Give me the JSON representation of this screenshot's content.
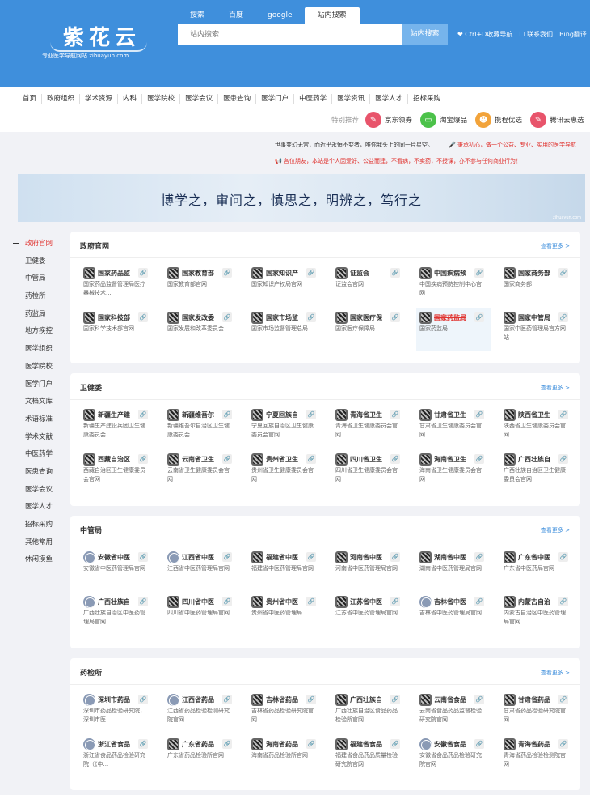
{
  "logo": {
    "main": "紫花云",
    "sub": "专业医学导航网站 zihuayun.com"
  },
  "search": {
    "tabs": [
      "搜索",
      "百度",
      "google",
      "站内搜索"
    ],
    "active_tab": 3,
    "placeholder": "站内搜索",
    "button": "站内搜索"
  },
  "header_links": [
    "❤ Ctrl+D收藏导航",
    "☐ 联系我们",
    "Bing翻译"
  ],
  "nav": [
    "首页",
    "政府组织",
    "学术资源",
    "内科",
    "医学院校",
    "医学会议",
    "医患查询",
    "医学门户",
    "中医药学",
    "医学资讯",
    "医学人才",
    "招标采购"
  ],
  "recommend": {
    "label": "特别推荐",
    "items": [
      {
        "label": "京东领券",
        "icon": "coupon-icon",
        "color": "#e8546b"
      },
      {
        "label": "淘宝爆品",
        "icon": "chat-icon",
        "color": "#4cc24a"
      },
      {
        "label": "携程优选",
        "icon": "mascot-icon",
        "color": "#f2a33a"
      },
      {
        "label": "腾讯云惠选",
        "icon": "coupon-icon",
        "color": "#e8546b"
      }
    ]
  },
  "notice": {
    "line1": "世事变幻无常，而近乎永恒不变者，唯你我头上的同一片星空。",
    "line1_right": "🎤 秉承初心，做一个公益、专业、实用的医学导航",
    "line2": "📢 各位朋友，本站是个人因爱好、公益而建，不看病，不卖药，不授课，亦不参与任何商业行为！"
  },
  "banner": {
    "text": "博学之，审问之，慎思之，明辨之，笃行之",
    "small": "zihuayun.com"
  },
  "sidebar": [
    "政府官网",
    "卫健委",
    "中管局",
    "药检所",
    "药监局",
    "地方疾控",
    "医学组织",
    "医学院校",
    "医学门户",
    "文档文库",
    "术语标准",
    "学术文献",
    "中医药学",
    "医患查询",
    "医学会议",
    "医学人才",
    "招标采购",
    "其他常用",
    "休闲摸鱼"
  ],
  "more_label": "查看更多 >",
  "sections": [
    {
      "title": "政府官网",
      "cards": [
        {
          "name": "国家药品监",
          "desc": "国家药品监督管理局医疗器械技术...",
          "icon": "qr"
        },
        {
          "name": "国家教育部",
          "desc": "国家教育部官网",
          "icon": "qr"
        },
        {
          "name": "国家知识产",
          "desc": "国家知识产权局官网",
          "icon": "qr"
        },
        {
          "name": "证监会",
          "desc": "证监会官网",
          "icon": "qr"
        },
        {
          "name": "中国疾病预",
          "desc": "中国疾病预防控制中心官网",
          "icon": "qr"
        },
        {
          "name": "国家商务部",
          "desc": "国家商务部",
          "icon": "qr"
        },
        {
          "name": "国家科技部",
          "desc": "国家科学技术部官网",
          "icon": "qr"
        },
        {
          "name": "国家发改委",
          "desc": "国家发展和改革委员会",
          "icon": "qr"
        },
        {
          "name": "国家市场监",
          "desc": "国家市场监督管理总局",
          "icon": "qr"
        },
        {
          "name": "国家医疗保",
          "desc": "国家医疗保障局",
          "icon": "qr"
        },
        {
          "name": "国家药监局",
          "desc": "国家药监局",
          "icon": "qr",
          "highlight": true
        },
        {
          "name": "国家中管局",
          "desc": "国家中医药管理局官方网站",
          "icon": "qr"
        }
      ]
    },
    {
      "title": "卫健委",
      "cards": [
        {
          "name": "新疆生产建",
          "desc": "新疆生产建设兵团卫生健康委员会...",
          "icon": "qr"
        },
        {
          "name": "新疆维吾尔",
          "desc": "新疆维吾尔自治区卫生健康委员会...",
          "icon": "qr"
        },
        {
          "name": "宁夏回族自",
          "desc": "宁夏回族自治区卫生健康委员会官网",
          "icon": "qr"
        },
        {
          "name": "青海省卫生",
          "desc": "青海省卫生健康委员会官网",
          "icon": "qr"
        },
        {
          "name": "甘肃省卫生",
          "desc": "甘肃省卫生健康委员会官网",
          "icon": "qr"
        },
        {
          "name": "陕西省卫生",
          "desc": "陕西省卫生健康委员会官网",
          "icon": "qr"
        },
        {
          "name": "西藏自治区",
          "desc": "西藏自治区卫生健康委员会官网",
          "icon": "qr"
        },
        {
          "name": "云南省卫生",
          "desc": "云南省卫生健康委员会官网",
          "icon": "qr"
        },
        {
          "name": "贵州省卫生",
          "desc": "贵州省卫生健康委员会官网",
          "icon": "qr"
        },
        {
          "name": "四川省卫生",
          "desc": "四川省卫生健康委员会官网",
          "icon": "qr"
        },
        {
          "name": "海南省卫生",
          "desc": "海南省卫生健康委员会官网",
          "icon": "qr"
        },
        {
          "name": "广西壮族自",
          "desc": "广西壮族自治区卫生健康委员会官网",
          "icon": "qr"
        }
      ]
    },
    {
      "title": "中管局",
      "cards": [
        {
          "name": "安徽省中医",
          "desc": "安徽省中医药管理局官网",
          "icon": "seal"
        },
        {
          "name": "江西省中医",
          "desc": "江西省中医药管理局官网",
          "icon": "seal"
        },
        {
          "name": "福建省中医",
          "desc": "福建省中医药管理局官网",
          "icon": "qr"
        },
        {
          "name": "河南省中医",
          "desc": "河南省中医药管理局官网",
          "icon": "qr"
        },
        {
          "name": "湖南省中医",
          "desc": "湖南省中医药管理局官网",
          "icon": "qr"
        },
        {
          "name": "广东省中医",
          "desc": "广东省中医药局官网",
          "icon": "qr"
        },
        {
          "name": "广西壮族自",
          "desc": "广西壮族自治区中医药管理局官网",
          "icon": "seal"
        },
        {
          "name": "四川省中医",
          "desc": "四川省中医药管理局官网",
          "icon": "qr"
        },
        {
          "name": "贵州省中医",
          "desc": "贵州省中医药管理局",
          "icon": "qr"
        },
        {
          "name": "江苏省中医",
          "desc": "江苏省中医药管理局官网",
          "icon": "qr"
        },
        {
          "name": "吉林省中医",
          "desc": "吉林省中医药管理局官网",
          "icon": "seal"
        },
        {
          "name": "内蒙古自治",
          "desc": "内蒙古自治区中医药管理局官网",
          "icon": "qr"
        }
      ]
    },
    {
      "title": "药检所",
      "cards": [
        {
          "name": "深圳市药品",
          "desc": "深圳市药品检验研究院，深圳市医...",
          "icon": "seal"
        },
        {
          "name": "江西省药品",
          "desc": "江西省药品检验检测研究院官网",
          "icon": "seal"
        },
        {
          "name": "吉林省药品",
          "desc": "吉林省药品检验研究院官网",
          "icon": "qr"
        },
        {
          "name": "广西壮族自",
          "desc": "广西壮族自治区食品药品检验所官网",
          "icon": "qr"
        },
        {
          "name": "云南省食品",
          "desc": "云南省食品药品监督检验研究院官网",
          "icon": "qr"
        },
        {
          "name": "甘肃省药品",
          "desc": "甘肃省药品检验研究院官网",
          "icon": "qr"
        },
        {
          "name": "浙江省食品",
          "desc": "浙江省食品药品检验研究院（《中...",
          "icon": "seal"
        },
        {
          "name": "广东省药品",
          "desc": "广东省药品检验所官网",
          "icon": "qr"
        },
        {
          "name": "海南省药品",
          "desc": "海南省药品检验所官网",
          "icon": "qr"
        },
        {
          "name": "福建省食品",
          "desc": "福建省食品药品质量检验研究院官网",
          "icon": "qr"
        },
        {
          "name": "安徽省食品",
          "desc": "安徽省食品药品检验研究院官网",
          "icon": "seal"
        },
        {
          "name": "青海省药品",
          "desc": "青海省药品检验检测院官网",
          "icon": "qr"
        }
      ]
    }
  ]
}
